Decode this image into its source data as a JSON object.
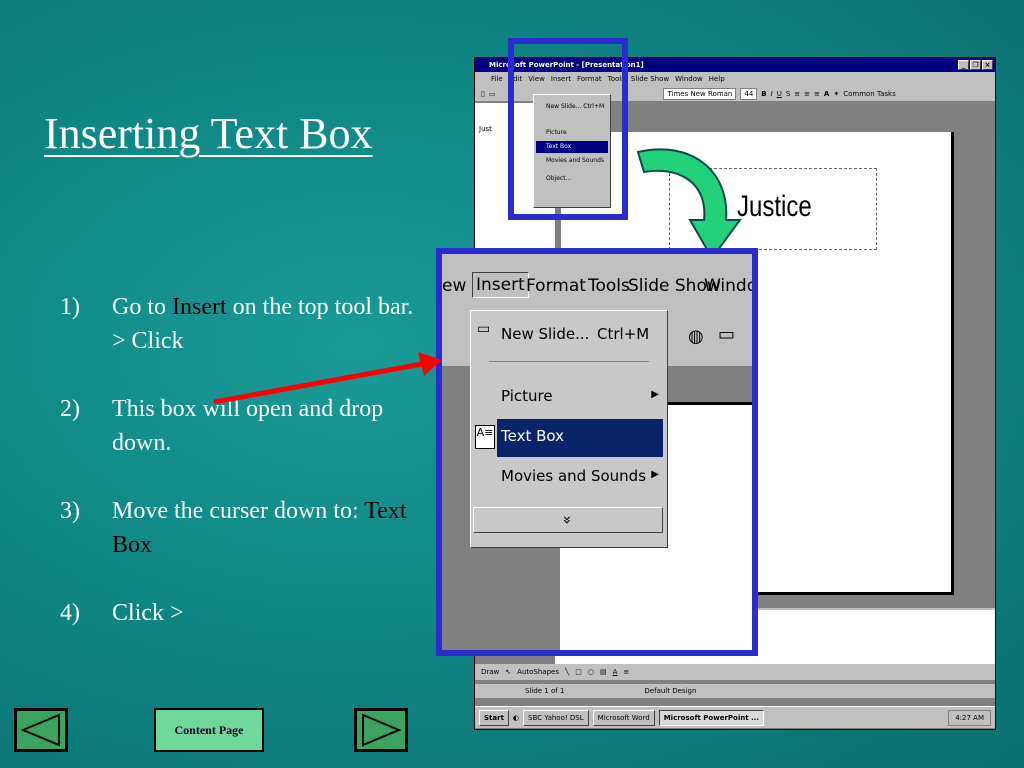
{
  "slide": {
    "title": "Inserting Text Box",
    "steps": [
      {
        "num": "1)",
        "pre": "Go to ",
        "highlight": "Insert",
        "post": " on the top tool bar. > Click"
      },
      {
        "num": "2)",
        "text": "This box will open and drop down."
      },
      {
        "num": "3)",
        "pre": "Move the curser down to: ",
        "highlight": "Text Box"
      },
      {
        "num": "4)",
        "text": "Click >"
      }
    ]
  },
  "screenshot": {
    "window_title": "Microsoft PowerPoint - [Presentation1]",
    "menus": [
      "File",
      "Edit",
      "View",
      "Insert",
      "Format",
      "Tools",
      "Slide Show",
      "Window",
      "Help"
    ],
    "font_name": "Times New Roman",
    "font_size": "44",
    "common_tasks": "Common Tasks",
    "outline_text": "Just",
    "slide_text": "Justice",
    "mini_menu": [
      "New Slide...   Ctrl+M",
      "Picture",
      "Text Box",
      "Movies and Sounds",
      "Object..."
    ],
    "draw_toolbar": [
      "Draw",
      "AutoShapes"
    ],
    "status": {
      "slide": "Slide 1 of 1",
      "design": "Default Design"
    },
    "taskbar": {
      "start": "Start",
      "tasks": [
        "SBC Yahoo! DSL",
        "Microsoft Word",
        "Microsoft PowerPoint ..."
      ],
      "clock": "4:27 AM"
    }
  },
  "zoom": {
    "menus": [
      "ew",
      "Insert",
      "Format",
      "Tools",
      "Slide Show",
      "Window"
    ],
    "dropdown": {
      "new_slide": "New Slide...",
      "shortcut": "Ctrl+M",
      "picture": "Picture",
      "text_box": "Text Box",
      "movies": "Movies and Sounds",
      "more": "»"
    }
  },
  "nav": {
    "content_page": "Content Page"
  },
  "colors": {
    "background": "#0f8785",
    "highlight_box": "#2b2bd0",
    "arrow_red": "#ff0000",
    "arrow_green": "#22d27a",
    "nav_button": "#3aa35e"
  }
}
